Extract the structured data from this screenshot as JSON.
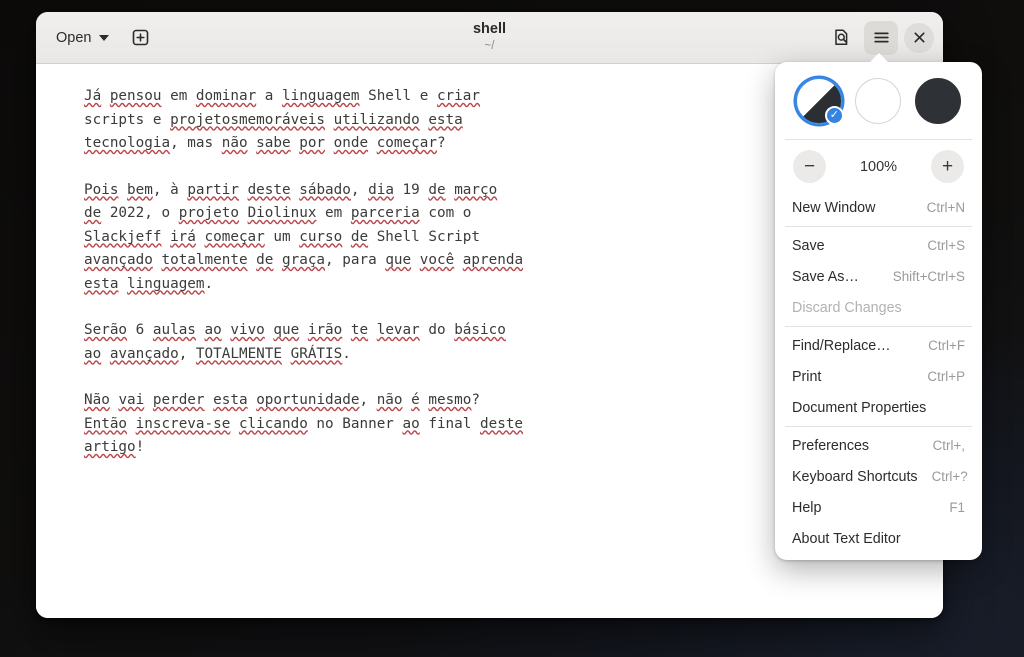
{
  "window": {
    "title": "shell",
    "subtitle": "~/"
  },
  "headerbar": {
    "open_label": "Open",
    "open_icon": "chevron-down-icon",
    "new_document_icon": "plus-square-icon",
    "find_in_document_icon": "document-search-icon",
    "menu_icon": "hamburger-menu-icon",
    "close_icon": "close-icon"
  },
  "document": {
    "paragraphs": [
      [
        [
          {
            "t": "Já",
            "sp": true
          },
          {
            "t": " "
          },
          {
            "t": "pensou",
            "sp": true
          },
          {
            "t": " em "
          },
          {
            "t": "dominar",
            "sp": true
          },
          {
            "t": " a "
          },
          {
            "t": "linguagem",
            "sp": true
          },
          {
            "t": " Shell e "
          },
          {
            "t": "criar",
            "sp": true
          }
        ],
        [
          {
            "t": "scripts e "
          },
          {
            "t": "projetosmemoráveis",
            "sp": true
          },
          {
            "t": " "
          },
          {
            "t": "utilizando",
            "sp": true
          },
          {
            "t": " "
          },
          {
            "t": "esta",
            "sp": true
          }
        ],
        [
          {
            "t": "tecnologia",
            "sp": true
          },
          {
            "t": ", mas "
          },
          {
            "t": "não",
            "sp": true
          },
          {
            "t": " "
          },
          {
            "t": "sabe",
            "sp": true
          },
          {
            "t": " "
          },
          {
            "t": "por",
            "sp": true
          },
          {
            "t": " "
          },
          {
            "t": "onde",
            "sp": true
          },
          {
            "t": " "
          },
          {
            "t": "começar",
            "sp": true
          },
          {
            "t": "?"
          }
        ]
      ],
      [
        [
          {
            "t": "Pois",
            "sp": true
          },
          {
            "t": " "
          },
          {
            "t": "bem",
            "sp": true
          },
          {
            "t": ", à "
          },
          {
            "t": "partir",
            "sp": true
          },
          {
            "t": " "
          },
          {
            "t": "deste",
            "sp": true
          },
          {
            "t": " "
          },
          {
            "t": "sábado",
            "sp": true
          },
          {
            "t": ", "
          },
          {
            "t": "dia",
            "sp": true
          },
          {
            "t": " 19 "
          },
          {
            "t": "de",
            "sp": true
          },
          {
            "t": " "
          },
          {
            "t": "março",
            "sp": true
          }
        ],
        [
          {
            "t": "de",
            "sp": true
          },
          {
            "t": " 2022, o "
          },
          {
            "t": "projeto",
            "sp": true
          },
          {
            "t": " "
          },
          {
            "t": "Diolinux",
            "sp": true
          },
          {
            "t": " em "
          },
          {
            "t": "parceria",
            "sp": true
          },
          {
            "t": " com o"
          }
        ],
        [
          {
            "t": "Slackjeff",
            "sp": true
          },
          {
            "t": " "
          },
          {
            "t": "irá",
            "sp": true
          },
          {
            "t": " "
          },
          {
            "t": "começar",
            "sp": true
          },
          {
            "t": " um "
          },
          {
            "t": "curso",
            "sp": true
          },
          {
            "t": " "
          },
          {
            "t": "de",
            "sp": true
          },
          {
            "t": " Shell Script"
          }
        ],
        [
          {
            "t": "avançado",
            "sp": true
          },
          {
            "t": " "
          },
          {
            "t": "totalmente",
            "sp": true
          },
          {
            "t": " "
          },
          {
            "t": "de",
            "sp": true
          },
          {
            "t": " "
          },
          {
            "t": "graça",
            "sp": true
          },
          {
            "t": ", para "
          },
          {
            "t": "que",
            "sp": true
          },
          {
            "t": " "
          },
          {
            "t": "você",
            "sp": true
          },
          {
            "t": " "
          },
          {
            "t": "aprenda",
            "sp": true
          }
        ],
        [
          {
            "t": "esta",
            "sp": true
          },
          {
            "t": " "
          },
          {
            "t": "linguagem",
            "sp": true
          },
          {
            "t": "."
          }
        ]
      ],
      [
        [
          {
            "t": "Serão",
            "sp": true
          },
          {
            "t": " 6 "
          },
          {
            "t": "aulas",
            "sp": true
          },
          {
            "t": " "
          },
          {
            "t": "ao",
            "sp": true
          },
          {
            "t": " "
          },
          {
            "t": "vivo",
            "sp": true
          },
          {
            "t": " "
          },
          {
            "t": "que",
            "sp": true
          },
          {
            "t": " "
          },
          {
            "t": "irão",
            "sp": true
          },
          {
            "t": " "
          },
          {
            "t": "te",
            "sp": true
          },
          {
            "t": " "
          },
          {
            "t": "levar",
            "sp": true
          },
          {
            "t": " do "
          },
          {
            "t": "básico",
            "sp": true
          }
        ],
        [
          {
            "t": "ao",
            "sp": true
          },
          {
            "t": " "
          },
          {
            "t": "avançado",
            "sp": true
          },
          {
            "t": ", "
          },
          {
            "t": "TOTALMENTE",
            "sp": true
          },
          {
            "t": " "
          },
          {
            "t": "GRÁTIS",
            "sp": true
          },
          {
            "t": "."
          }
        ]
      ],
      [
        [
          {
            "t": "Não",
            "sp": true
          },
          {
            "t": " "
          },
          {
            "t": "vai",
            "sp": true
          },
          {
            "t": " "
          },
          {
            "t": "perder",
            "sp": true
          },
          {
            "t": " "
          },
          {
            "t": "esta",
            "sp": true
          },
          {
            "t": " "
          },
          {
            "t": "oportunidade",
            "sp": true
          },
          {
            "t": ", "
          },
          {
            "t": "não",
            "sp": true
          },
          {
            "t": " "
          },
          {
            "t": "é",
            "sp": true
          },
          {
            "t": " "
          },
          {
            "t": "mesmo",
            "sp": true
          },
          {
            "t": "?"
          }
        ],
        [
          {
            "t": "Então",
            "sp": true
          },
          {
            "t": " "
          },
          {
            "t": "inscreva-se",
            "sp": true
          },
          {
            "t": " "
          },
          {
            "t": "clicando",
            "sp": true
          },
          {
            "t": " no Banner "
          },
          {
            "t": "ao",
            "sp": true
          },
          {
            "t": " final "
          },
          {
            "t": "deste",
            "sp": true
          }
        ],
        [
          {
            "t": "artigo",
            "sp": true
          },
          {
            "t": "!"
          }
        ]
      ]
    ]
  },
  "menu": {
    "themes": [
      {
        "name": "system",
        "label": "Follow system style",
        "selected": true,
        "check": "✓"
      },
      {
        "name": "light",
        "label": "Light style",
        "selected": false
      },
      {
        "name": "dark",
        "label": "Dark style",
        "selected": false
      }
    ],
    "zoom": {
      "out_label": "−",
      "level": "100%",
      "in_label": "+"
    },
    "groups": [
      [
        {
          "label": "New Window",
          "accel": "Ctrl+N",
          "disabled": false,
          "name": "new-window"
        }
      ],
      [
        {
          "label": "Save",
          "accel": "Ctrl+S",
          "disabled": false,
          "name": "save"
        },
        {
          "label": "Save As…",
          "accel": "Shift+Ctrl+S",
          "disabled": false,
          "name": "save-as"
        },
        {
          "label": "Discard Changes",
          "accel": "",
          "disabled": true,
          "name": "discard-changes"
        }
      ],
      [
        {
          "label": "Find/Replace…",
          "accel": "Ctrl+F",
          "disabled": false,
          "name": "find-replace"
        },
        {
          "label": "Print",
          "accel": "Ctrl+P",
          "disabled": false,
          "name": "print"
        },
        {
          "label": "Document Properties",
          "accel": "",
          "disabled": false,
          "name": "document-properties"
        }
      ],
      [
        {
          "label": "Preferences",
          "accel": "Ctrl+,",
          "disabled": false,
          "name": "preferences"
        },
        {
          "label": "Keyboard Shortcuts",
          "accel": "Ctrl+?",
          "disabled": false,
          "name": "keyboard-shortcuts"
        },
        {
          "label": "Help",
          "accel": "F1",
          "disabled": false,
          "name": "help"
        },
        {
          "label": "About Text Editor",
          "accel": "",
          "disabled": false,
          "name": "about-text-editor"
        }
      ]
    ]
  },
  "colors": {
    "accent": "#3584e4",
    "spellcheck": "#b9484c",
    "headerbar": "#ecebe9",
    "text": "#3b3b39"
  }
}
